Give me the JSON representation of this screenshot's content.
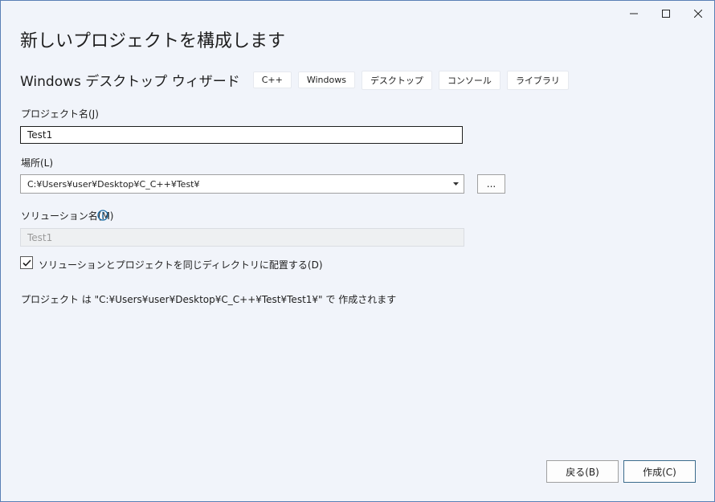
{
  "titlebar": {
    "minimize_icon": "minimize-icon",
    "maximize_icon": "maximize-icon",
    "close_icon": "close-icon"
  },
  "page_title": "新しいプロジェクトを構成します",
  "template": {
    "name": "Windows デスクトップ ウィザード",
    "tags": [
      "C++",
      "Windows",
      "デスクトップ",
      "コンソール",
      "ライブラリ"
    ]
  },
  "project_name": {
    "label": "プロジェクト名(J)",
    "value": "Test1"
  },
  "location": {
    "label": "場所(L)",
    "value": "C:¥Users¥user¥Desktop¥C_C++¥Test¥",
    "browse_label": "..."
  },
  "solution_name": {
    "label": "ソリューション名(M)",
    "value": "Test1",
    "info_icon": "info-icon"
  },
  "same_dir_checkbox": {
    "label": "ソリューションとプロジェクトを同じディレクトリに配置する(D)",
    "checked": true
  },
  "path_summary": "プロジェクト は \"C:¥Users¥user¥Desktop¥C_C++¥Test¥Test1¥\" で 作成されます",
  "footer": {
    "back_label": "戻る(B)",
    "create_label": "作成(C)"
  },
  "colors": {
    "accent_info": "#1f6fa8",
    "background": "#f1f4fa"
  }
}
